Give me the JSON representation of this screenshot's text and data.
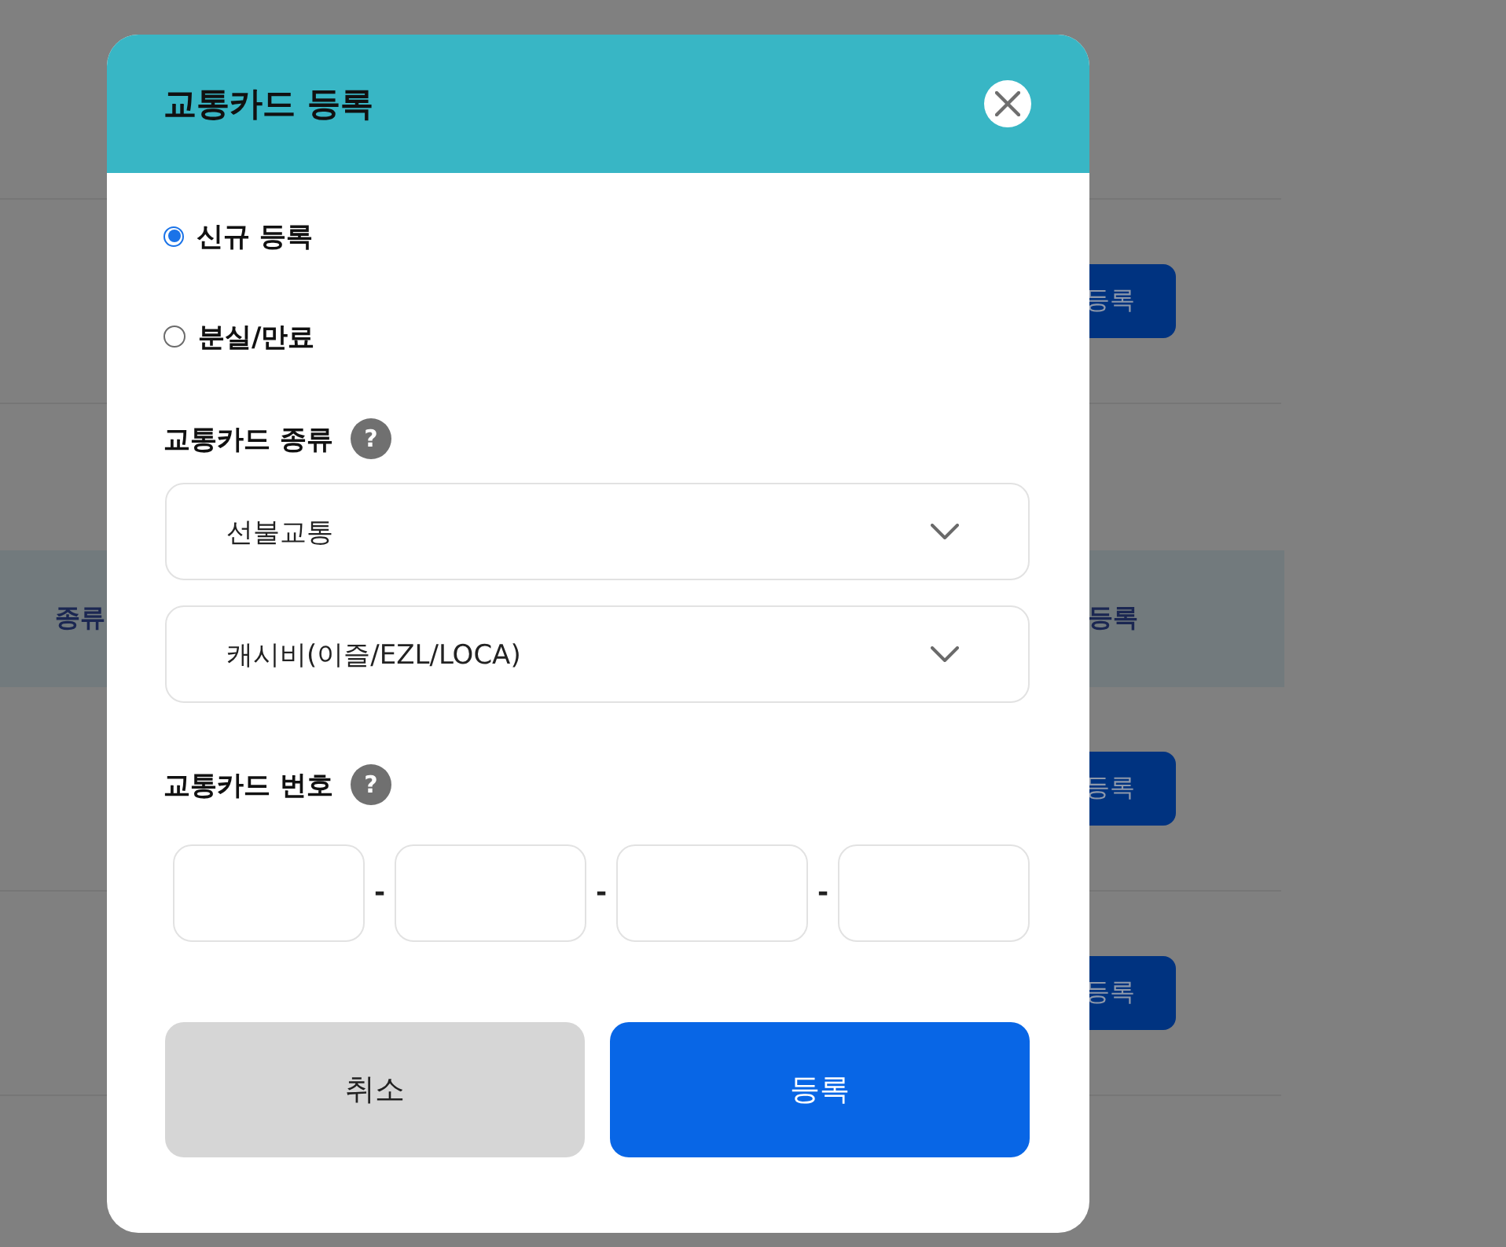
{
  "background_page": {
    "upper_rows": [
      {
        "action": "등록"
      }
    ],
    "table": {
      "columns": [
        "종류",
        "등록"
      ],
      "rows": [
        {
          "action": "등록"
        },
        {
          "action": "등록"
        }
      ]
    }
  },
  "dialog": {
    "title": "교통카드 등록",
    "options": [
      {
        "label": "신규 등록",
        "selected": true
      },
      {
        "label": "분실/만료",
        "selected": false
      }
    ],
    "card_type": {
      "label": "교통카드 종류",
      "help": "?",
      "selects": [
        {
          "value": "선불교통"
        },
        {
          "value": "캐시비(이즐/EZL/LOCA)"
        }
      ]
    },
    "card_number": {
      "label": "교통카드 번호",
      "help": "?",
      "separators": [
        "-",
        "-",
        "-"
      ]
    },
    "buttons": [
      {
        "label": "취소",
        "kind": "secondary"
      },
      {
        "label": "등록",
        "kind": "primary"
      }
    ]
  }
}
